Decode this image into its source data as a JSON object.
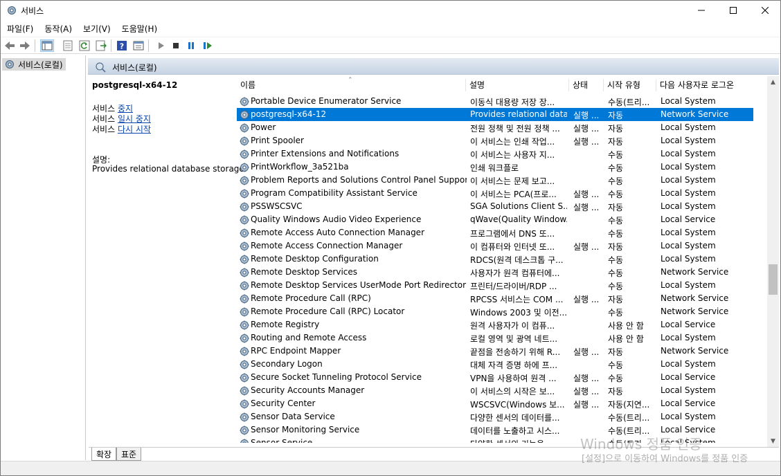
{
  "window": {
    "title": "서비스",
    "icon": "gear-icon"
  },
  "menu": [
    "파일(F)",
    "동작(A)",
    "보기(V)",
    "도움말(H)"
  ],
  "tree": {
    "item": "서비스(로컬)"
  },
  "main": {
    "header": "서비스(로컬)"
  },
  "detail": {
    "service_name": "postgresql-x64-12",
    "prefix": "서비스",
    "stop": "중지",
    "pause": "일시 중지",
    "restart": "다시 시작",
    "desc_label": "설명:",
    "desc_text": "Provides relational database storage."
  },
  "columns": {
    "name": "이름",
    "desc": "설명",
    "state": "상태",
    "start": "시작 유형",
    "logon": "다음 사용자로 로그온"
  },
  "rows": [
    {
      "name": "Portable Device Enumerator Service",
      "desc": "이동식 대용량 저장 장...",
      "state": "",
      "start": "수동(트리...",
      "logon": "Local System"
    },
    {
      "name": "postgresql-x64-12",
      "desc": "Provides relational data...",
      "state": "실행 ...",
      "start": "자동",
      "logon": "Network Service"
    },
    {
      "name": "Power",
      "desc": "전원 정책 및 전원 정책 ...",
      "state": "실행 ...",
      "start": "자동",
      "logon": "Local System"
    },
    {
      "name": "Print Spooler",
      "desc": "이 서비스는 인쇄 작업...",
      "state": "실행 ...",
      "start": "자동",
      "logon": "Local System"
    },
    {
      "name": "Printer Extensions and Notifications",
      "desc": "이 서비스는 사용자 지...",
      "state": "",
      "start": "수동",
      "logon": "Local System"
    },
    {
      "name": "PrintWorkflow_3a521ba",
      "desc": "인쇄 워크플로",
      "state": "",
      "start": "수동",
      "logon": "Local System"
    },
    {
      "name": "Problem Reports and Solutions Control Panel Support",
      "desc": "이 서비스는 문제 보고...",
      "state": "",
      "start": "수동",
      "logon": "Local System"
    },
    {
      "name": "Program Compatibility Assistant Service",
      "desc": "이 서비스는 PCA(프로...",
      "state": "실행 ...",
      "start": "수동",
      "logon": "Local System"
    },
    {
      "name": "PSSWSCSVC",
      "desc": "SGA Solutions Client S...",
      "state": "실행 ...",
      "start": "자동",
      "logon": "Local System"
    },
    {
      "name": "Quality Windows Audio Video Experience",
      "desc": "qWave(Quality Window...",
      "state": "",
      "start": "수동",
      "logon": "Local Service"
    },
    {
      "name": "Remote Access Auto Connection Manager",
      "desc": "프로그램에서 DNS 또...",
      "state": "",
      "start": "수동",
      "logon": "Local System"
    },
    {
      "name": "Remote Access Connection Manager",
      "desc": "이 컴퓨터와 인터넷 또...",
      "state": "실행 ...",
      "start": "자동",
      "logon": "Local System"
    },
    {
      "name": "Remote Desktop Configuration",
      "desc": "RDCS(원격 데스크톱 구...",
      "state": "",
      "start": "수동",
      "logon": "Local System"
    },
    {
      "name": "Remote Desktop Services",
      "desc": "사용자가 원격 컴퓨터에...",
      "state": "",
      "start": "수동",
      "logon": "Network Service"
    },
    {
      "name": "Remote Desktop Services UserMode Port Redirector",
      "desc": "프린터/드라이버/RDP ...",
      "state": "",
      "start": "수동",
      "logon": "Local System"
    },
    {
      "name": "Remote Procedure Call (RPC)",
      "desc": "RPCSS 서비스는 COM ...",
      "state": "실행 ...",
      "start": "자동",
      "logon": "Network Service"
    },
    {
      "name": "Remote Procedure Call (RPC) Locator",
      "desc": "Windows 2003 및 이전...",
      "state": "",
      "start": "수동",
      "logon": "Network Service"
    },
    {
      "name": "Remote Registry",
      "desc": "원격 사용자가 이 컴퓨...",
      "state": "",
      "start": "사용 안 함",
      "logon": "Local Service"
    },
    {
      "name": "Routing and Remote Access",
      "desc": "로컬 영역 및 광역 네트...",
      "state": "",
      "start": "사용 안 함",
      "logon": "Local System"
    },
    {
      "name": "RPC Endpoint Mapper",
      "desc": "끝점을 전송하기 위해 R...",
      "state": "실행 ...",
      "start": "자동",
      "logon": "Network Service"
    },
    {
      "name": "Secondary Logon",
      "desc": "대체 자격 증명 하에 프...",
      "state": "",
      "start": "수동",
      "logon": "Local System"
    },
    {
      "name": "Secure Socket Tunneling Protocol Service",
      "desc": "VPN을 사용하여 원격 ...",
      "state": "실행 ...",
      "start": "수동",
      "logon": "Local Service"
    },
    {
      "name": "Security Accounts Manager",
      "desc": "이 서비스의 시작은 보...",
      "state": "실행 ...",
      "start": "자동",
      "logon": "Local System"
    },
    {
      "name": "Security Center",
      "desc": "WSCSVC(Windows 보...",
      "state": "실행 ...",
      "start": "자동(지연...",
      "logon": "Local Service"
    },
    {
      "name": "Sensor Data Service",
      "desc": "다양한 센서의 데이터를...",
      "state": "",
      "start": "수동(트리...",
      "logon": "Local System"
    },
    {
      "name": "Sensor Monitoring Service",
      "desc": "데이터를 노출하고 시스...",
      "state": "",
      "start": "수동(트리...",
      "logon": "Local Service"
    },
    {
      "name": "Sensor Service",
      "desc": "다양한 센서의 기능을 ...",
      "state": "",
      "start": "수동(트리...",
      "logon": "Local System"
    }
  ],
  "selected_row_index": 1,
  "tabs": [
    "확장",
    "표준"
  ],
  "watermark": {
    "line1": "Windows 정품 인증",
    "line2": "[설정]으로 이동하여 Windows를 정품 인증"
  }
}
